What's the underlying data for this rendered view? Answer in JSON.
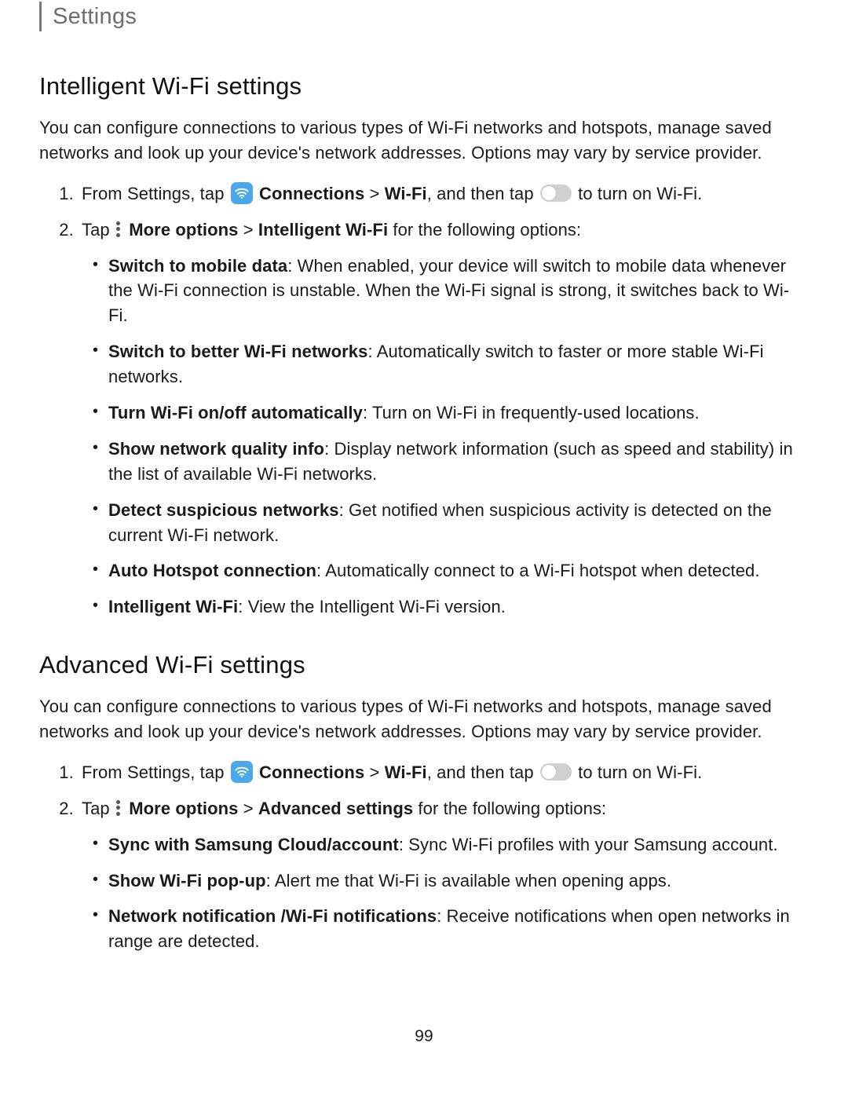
{
  "header": {
    "title": "Settings"
  },
  "section1": {
    "heading": "Intelligent Wi-Fi settings",
    "intro": "You can configure connections to various types of Wi-Fi networks and hotspots, manage saved networks and look up your device's network addresses. Options may vary by service provider.",
    "step1": {
      "pre": "From Settings, tap ",
      "connections": "Connections",
      "gt1": " > ",
      "wifi": "Wi-Fi",
      "mid": ", and then tap ",
      "post": " to turn on Wi-Fi."
    },
    "step2": {
      "pre": "Tap ",
      "more_options": "More options",
      "gt": " > ",
      "target": "Intelligent Wi-Fi",
      "post": " for the following options:"
    },
    "bullets": [
      {
        "term": "Switch to mobile data",
        "desc": ": When enabled, your device will switch to mobile data whenever the Wi-Fi connection is unstable. When the Wi-Fi signal is strong, it switches back to Wi-Fi."
      },
      {
        "term": "Switch to better Wi-Fi networks",
        "desc": ": Automatically switch to faster or more stable Wi-Fi networks."
      },
      {
        "term": "Turn Wi-Fi on/off automatically",
        "desc": ": Turn on Wi-Fi in frequently-used locations."
      },
      {
        "term": "Show network quality info",
        "desc": ": Display network information (such as speed and stability) in the list of available Wi-Fi networks."
      },
      {
        "term": "Detect suspicious networks",
        "desc": ": Get notified when suspicious activity is detected on the current Wi-Fi network."
      },
      {
        "term": "Auto Hotspot connection",
        "desc": ": Automatically connect to a Wi-Fi hotspot when detected."
      },
      {
        "term": "Intelligent Wi-Fi",
        "desc": ": View the Intelligent Wi-Fi version."
      }
    ]
  },
  "section2": {
    "heading": "Advanced Wi-Fi settings",
    "intro": "You can configure connections to various types of Wi-Fi networks and hotspots, manage saved networks and look up your device's network addresses. Options may vary by service provider.",
    "step1": {
      "pre": "From Settings, tap ",
      "connections": "Connections",
      "gt1": " > ",
      "wifi": "Wi-Fi",
      "mid": ", and then tap ",
      "post": " to turn on Wi-Fi."
    },
    "step2": {
      "pre": "Tap ",
      "more_options": "More options",
      "gt": " > ",
      "target": "Advanced settings",
      "post": " for the following options:"
    },
    "bullets": [
      {
        "term": "Sync with Samsung Cloud/account",
        "desc": ": Sync Wi-Fi profiles with your Samsung account."
      },
      {
        "term": "Show Wi-Fi pop-up",
        "desc": ": Alert me that Wi-Fi is available when opening apps."
      },
      {
        "term": "Network notification /Wi-Fi notifications",
        "desc": ": Receive notifications when open networks in range are detected."
      }
    ]
  },
  "page_number": "99"
}
